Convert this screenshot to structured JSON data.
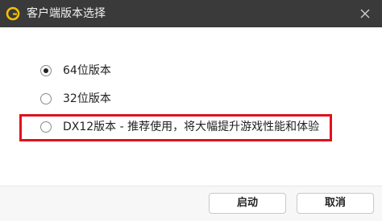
{
  "window": {
    "title": "客户端版本选择",
    "app_icon": "game-logo-icon",
    "close_icon": "close-icon"
  },
  "options": [
    {
      "label": "64位版本",
      "selected": true
    },
    {
      "label": "32位版本",
      "selected": false
    },
    {
      "label": "DX12版本 - 推荐使用，将大幅提升游戏性能和体验",
      "selected": false
    }
  ],
  "highlight_color": "#e0111b",
  "buttons": {
    "start": "启动",
    "cancel": "取消"
  }
}
